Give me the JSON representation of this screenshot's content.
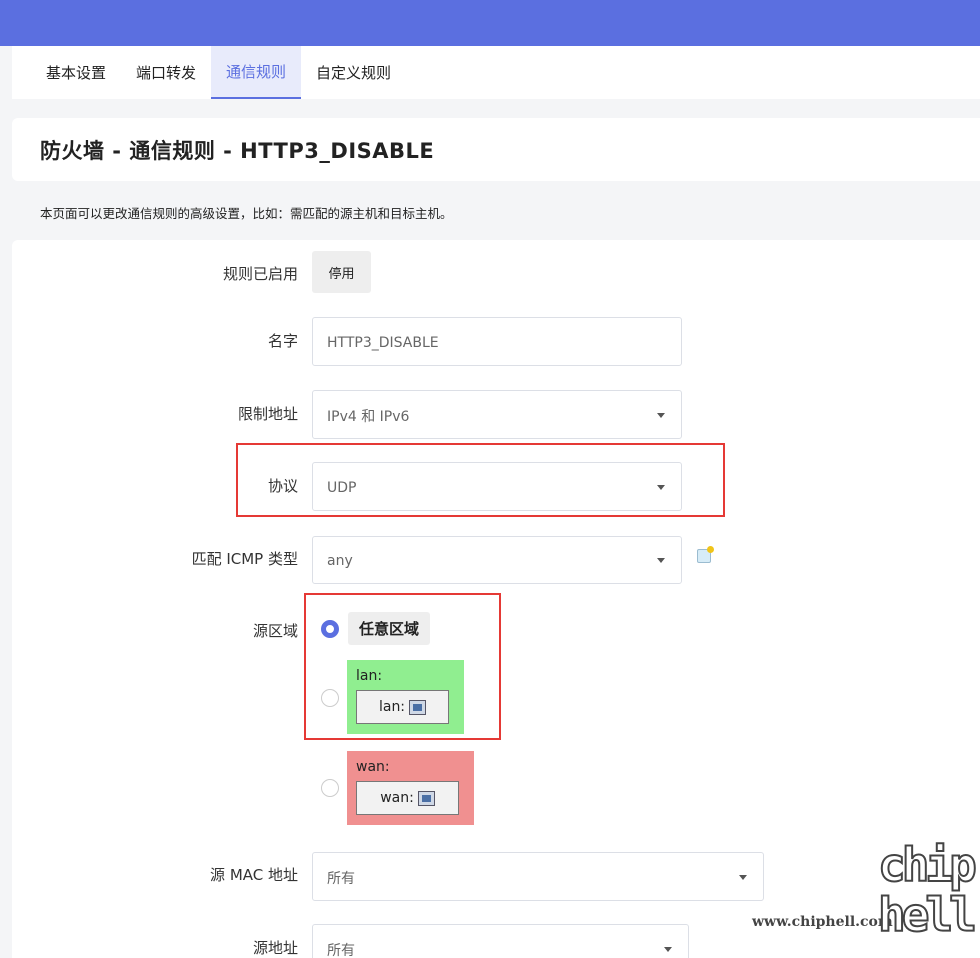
{
  "tabs": [
    "基本设置",
    "端口转发",
    "通信规则",
    "自定义规则"
  ],
  "active_tab": 2,
  "title": "防火墙 - 通信规则 - HTTP3_DISABLE",
  "description": "本页面可以更改通信规则的高级设置，比如：需匹配的源主机和目标主机。",
  "form": {
    "enabled": {
      "label": "规则已启用",
      "button": "停用"
    },
    "name": {
      "label": "名字",
      "value": "HTTP3_DISABLE"
    },
    "family": {
      "label": "限制地址",
      "value": "IPv4 和 IPv6"
    },
    "protocol": {
      "label": "协议",
      "value": "UDP"
    },
    "icmp": {
      "label": "匹配 ICMP 类型",
      "value": "any"
    },
    "src_zone": {
      "label": "源区域",
      "any_label": "任意区域",
      "lan": {
        "name": "lan:",
        "chip": "lan:",
        "color": "#90ee90"
      },
      "wan": {
        "name": "wan:",
        "chip": "wan:",
        "color": "#f09090"
      }
    },
    "src_mac": {
      "label": "源 MAC 地址",
      "value": "所有"
    },
    "src_ip": {
      "label": "源地址",
      "value": "所有"
    }
  },
  "colors": {
    "accent": "#5b6fe0",
    "highlight": "#e53935"
  },
  "watermark": {
    "text": "www.chiphell.com",
    "logo": "chip hell"
  }
}
